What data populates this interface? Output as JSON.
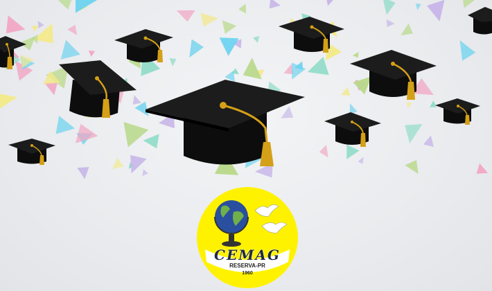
{
  "logo": {
    "name": "CEMAG",
    "city": "RESERVA-PR",
    "year": "1960"
  },
  "colors": {
    "background": "#e9ebee",
    "cap_black": "#111111",
    "tassel_gold": "#d4a017",
    "logo_yellow": "#fff200",
    "confetti": [
      "#6fd3ef",
      "#f2a7c4",
      "#f3e98a",
      "#b9d98b",
      "#c7b6e8",
      "#8fdcc8"
    ]
  },
  "icons": [
    "graduation-cap-icon",
    "globe-icon",
    "dove-icon",
    "confetti-shape"
  ]
}
